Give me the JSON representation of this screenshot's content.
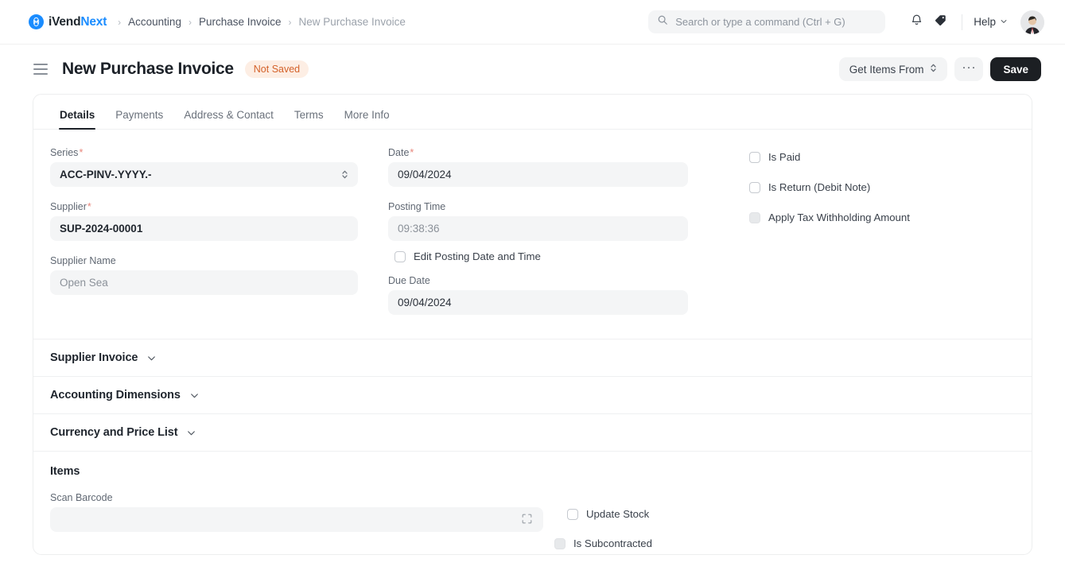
{
  "navbar": {
    "brand": {
      "primary": "iVend",
      "accent": "Next",
      "logo_icon": "ivend-logo-icon"
    },
    "breadcrumbs": [
      {
        "label": "Accounting",
        "muted": false
      },
      {
        "label": "Purchase Invoice",
        "muted": false
      },
      {
        "label": "New Purchase Invoice",
        "muted": true
      }
    ],
    "separator": "›",
    "search": {
      "placeholder": "Search or type a command (Ctrl + G)",
      "value": "",
      "icon": "search-icon"
    },
    "notifications_icon": "bell-icon",
    "tag_icon": "tag-icon",
    "help": {
      "label": "Help",
      "icon": "chevron-down-icon"
    },
    "avatar_icon": "user-avatar"
  },
  "pagehead": {
    "menu_icon": "hamburger-menu-icon",
    "title": "New Purchase Invoice",
    "status_badge": "Not Saved",
    "get_items_from": "Get Items From",
    "get_items_icon": "up-down-chevron-icon",
    "more_label": "···",
    "save_label": "Save"
  },
  "tabs": [
    {
      "label": "Details",
      "active": true
    },
    {
      "label": "Payments",
      "active": false
    },
    {
      "label": "Address & Contact",
      "active": false
    },
    {
      "label": "Terms",
      "active": false
    },
    {
      "label": "More Info",
      "active": false
    }
  ],
  "details": {
    "series": {
      "label": "Series",
      "required": true,
      "value": "ACC-PINV-.YYYY.-"
    },
    "supplier": {
      "label": "Supplier",
      "required": true,
      "value": "SUP-2024-00001"
    },
    "supplier_name": {
      "label": "Supplier Name",
      "required": false,
      "value": "Open Sea"
    },
    "date": {
      "label": "Date",
      "required": true,
      "value": "09/04/2024"
    },
    "posting_time": {
      "label": "Posting Time",
      "required": false,
      "value": "09:38:36"
    },
    "edit_posting": {
      "label": "Edit Posting Date and Time",
      "checked": false
    },
    "due_date": {
      "label": "Due Date",
      "required": false,
      "value": "09/04/2024"
    },
    "is_paid": {
      "label": "Is Paid",
      "checked": false,
      "disabled": false
    },
    "is_return": {
      "label": "Is Return (Debit Note)",
      "checked": false,
      "disabled": false
    },
    "apply_tax_withholding": {
      "label": "Apply Tax Withholding Amount",
      "checked": false,
      "disabled": true
    }
  },
  "sections": [
    {
      "title": "Supplier Invoice",
      "icon": "chevron-down-icon"
    },
    {
      "title": "Accounting Dimensions",
      "icon": "chevron-down-icon"
    },
    {
      "title": "Currency and Price List",
      "icon": "chevron-down-icon"
    }
  ],
  "items": {
    "title": "Items",
    "scan_barcode": {
      "label": "Scan Barcode",
      "value": "",
      "icon": "barcode-scan-icon"
    },
    "update_stock": {
      "label": "Update Stock",
      "checked": false,
      "disabled": false
    },
    "is_subcontracted": {
      "label": "Is Subcontracted",
      "checked": false,
      "disabled": true
    }
  },
  "colors": {
    "accent": "#1a8cff",
    "save_bg": "#1c1f23",
    "badge_bg": "#fdeee4",
    "badge_text": "#d4622a",
    "field_bg": "#f4f5f6",
    "required_star": "#e8857a"
  }
}
